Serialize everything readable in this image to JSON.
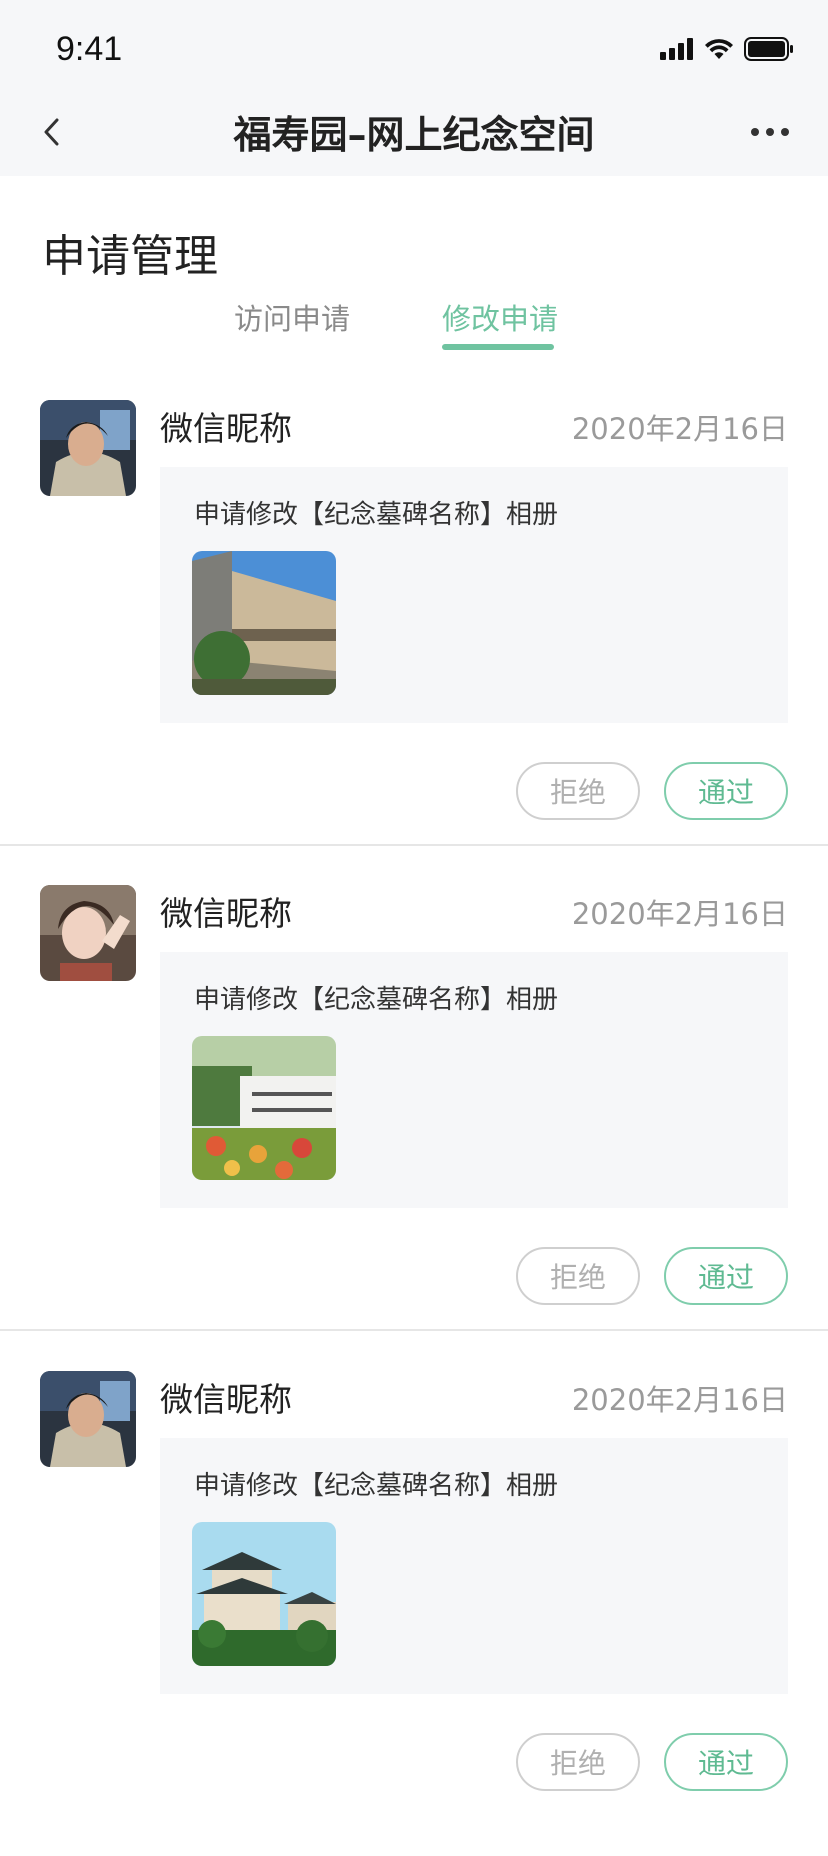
{
  "status_bar": {
    "time": "9:41",
    "icons": [
      "cellular-signal-icon",
      "wifi-icon",
      "battery-icon"
    ]
  },
  "nav": {
    "title": "福寿园–网上纪念空间",
    "back_icon": "chevron-left-icon",
    "more_icon": "more-dots-icon"
  },
  "page": {
    "title": "申请管理"
  },
  "tabs": [
    {
      "label": "访问申请",
      "active": false
    },
    {
      "label": "修改申请",
      "active": true
    }
  ],
  "requests": [
    {
      "nickname": "微信昵称",
      "date": "2020年2月16日",
      "text": "申请修改【纪念墓碑名称】相册",
      "reject_label": "拒绝",
      "approve_label": "通过"
    },
    {
      "nickname": "微信昵称",
      "date": "2020年2月16日",
      "text": "申请修改【纪念墓碑名称】相册",
      "reject_label": "拒绝",
      "approve_label": "通过"
    },
    {
      "nickname": "微信昵称",
      "date": "2020年2月16日",
      "text": "申请修改【纪念墓碑名称】相册",
      "reject_label": "拒绝",
      "approve_label": "通过"
    }
  ],
  "colors": {
    "accent": "#6fc3a0",
    "background_header": "#f6f7f9",
    "panel": "#f6f7f9"
  }
}
